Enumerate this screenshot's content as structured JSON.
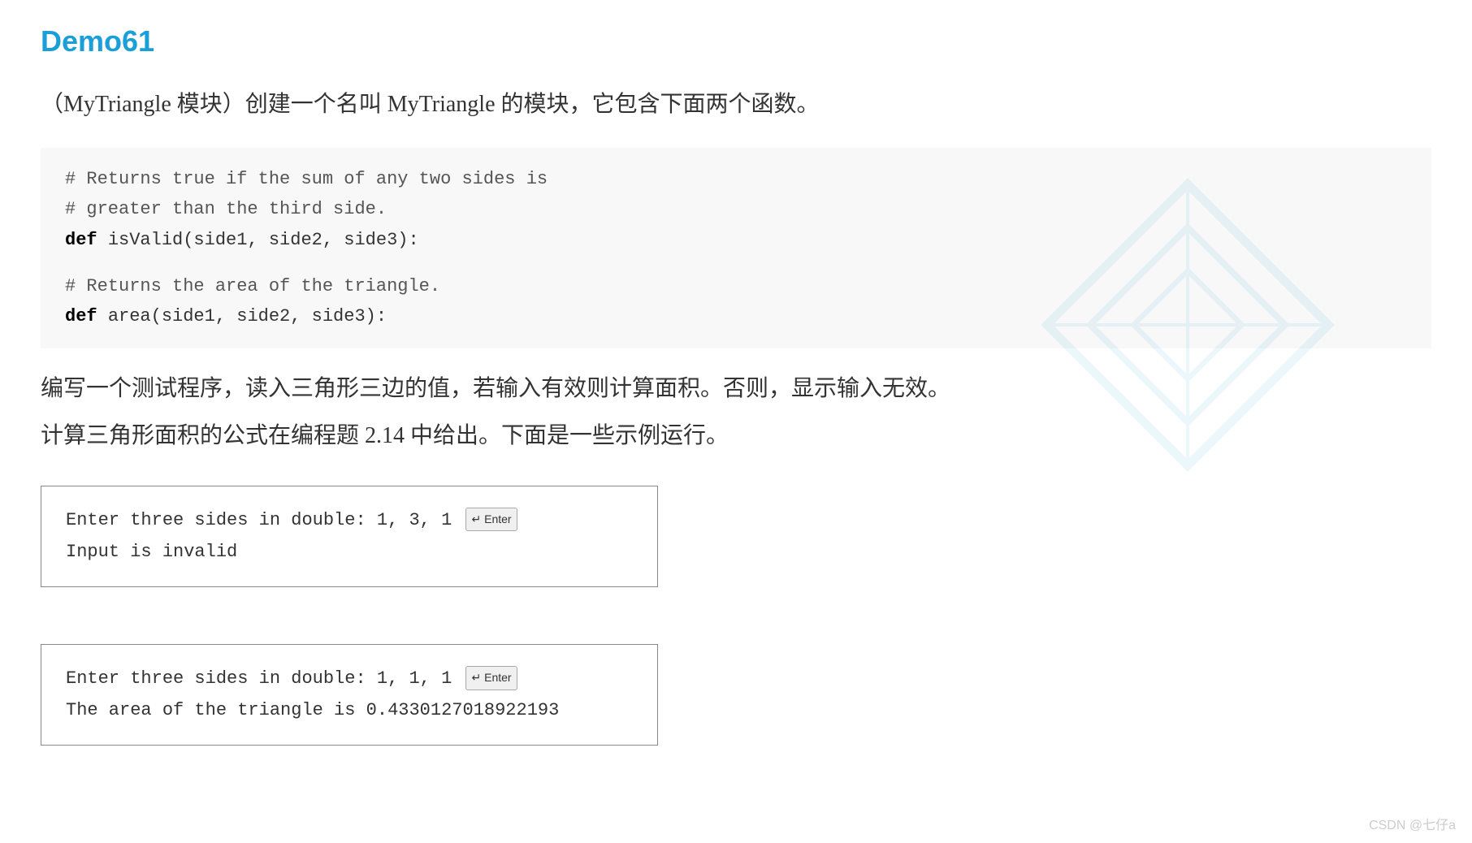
{
  "title": "Demo61",
  "description": "（MyTriangle 模块）创建一个名叫 MyTriangle 的模块，它包含下面两个函数。",
  "code": {
    "comment1": "# Returns true if the sum of any two sides is",
    "comment2": "#  greater than the third side.",
    "func1": "def isValid(side1, side2, side3):",
    "comment3": "# Returns the area of the triangle.",
    "func2": "def area(side1, side2, side3):"
  },
  "body_text_line1": "    编写一个测试程序，读入三角形三边的值，若输入有效则计算面积。否则，显示输入无效。",
  "body_text_line2": "计算三角形面积的公式在编程题 2.14 中给出。下面是一些示例运行。",
  "terminal1": {
    "line1_text": "Enter three sides in double: 1, 3, 1",
    "line1_enter": "↵ Enter",
    "line2": "Input is invalid"
  },
  "terminal2": {
    "line1_text": "Enter three sides in double: 1, 1, 1",
    "line1_enter": "↵ Enter",
    "line2": "The area of the triangle is 0.4330127018922193"
  },
  "footer": "CSDN @七仔a"
}
